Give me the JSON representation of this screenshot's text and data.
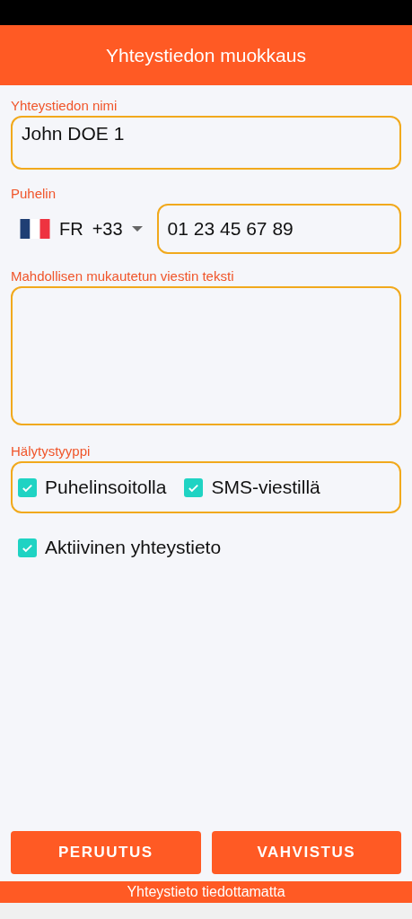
{
  "header": {
    "title": "Yhteystiedon muokkaus"
  },
  "name_field": {
    "label": "Yhteystiedon nimi",
    "value": "John DOE 1"
  },
  "phone": {
    "label": "Puhelin",
    "country": "FR",
    "dial_code": "+33",
    "value": "01 23 45 67 89"
  },
  "message_field": {
    "label": "Mahdollisen mukautetun viestin teksti"
  },
  "alert_type": {
    "label": "Hälytystyyppi",
    "options": [
      {
        "label": "Puhelinsoitolla",
        "checked": true
      },
      {
        "label": "SMS-viestillä",
        "checked": true
      }
    ]
  },
  "active": {
    "label": "Aktiivinen yhteystieto",
    "checked": true
  },
  "buttons": [
    "PERUUTUS",
    "VAHVISTUS"
  ],
  "status": "Yhteystieto tiedottamatta"
}
